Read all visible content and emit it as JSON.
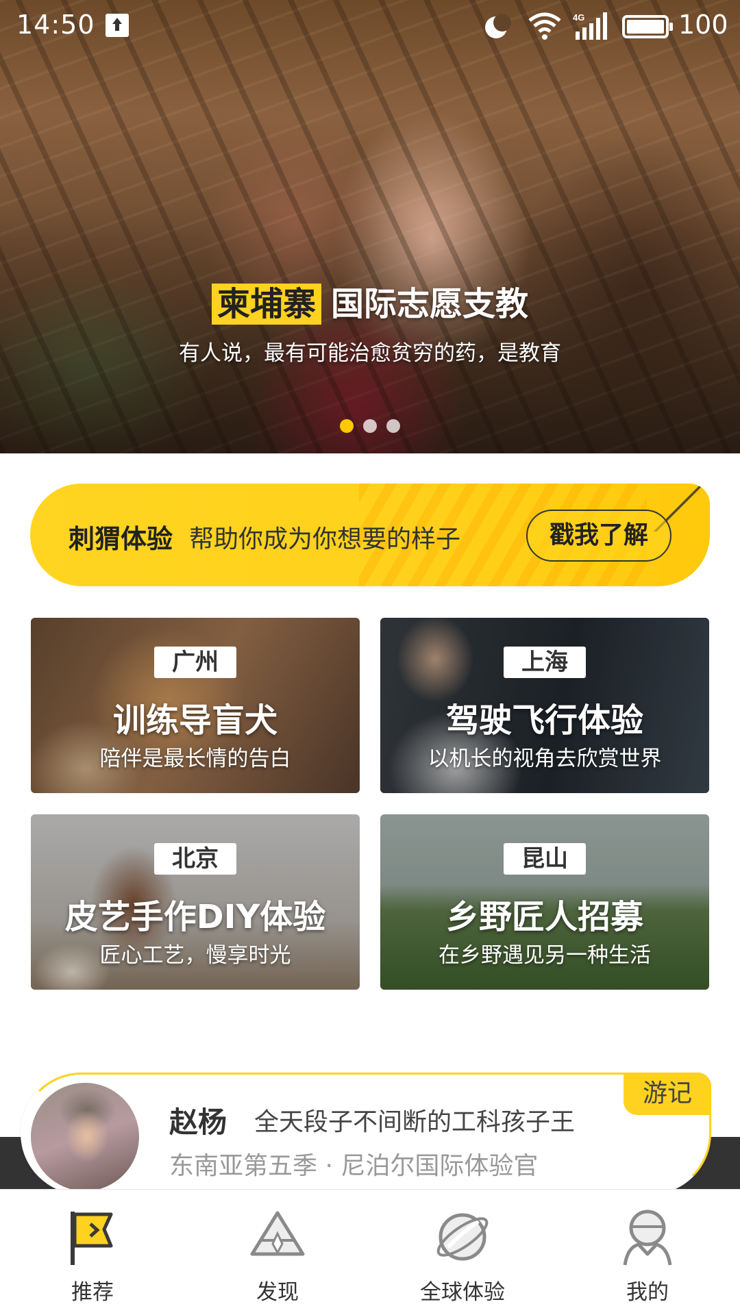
{
  "status_bar": {
    "time": "14:50",
    "battery": "100",
    "icons": [
      "upload-icon",
      "moon-icon",
      "wifi-icon",
      "signal-4g-icon",
      "battery-icon"
    ]
  },
  "hero": {
    "tag": "柬埔寨",
    "title": "国际志愿支教",
    "subtitle": "有人说，最有可能治愈贫穷的药，是教育",
    "slides": 3,
    "active_slide": 1
  },
  "promo": {
    "brand": "刺猬体验",
    "slogan": "帮助你成为你想要的样子",
    "button": "戳我了解"
  },
  "cards": [
    {
      "city": "广州",
      "title": "训练导盲犬",
      "subtitle": "陪伴是最长情的告白"
    },
    {
      "city": "上海",
      "title": "驾驶飞行体验",
      "subtitle": "以机长的视角去欣赏世界"
    },
    {
      "city": "北京",
      "title": "皮艺手作DIY体验",
      "subtitle": "匠心工艺，慢享时光"
    },
    {
      "city": "昆山",
      "title": "乡野匠人招募",
      "subtitle": "在乡野遇见另一种生活"
    }
  ],
  "story": {
    "name": "赵杨",
    "bio": "全天段子不间断的工科孩子王",
    "meta": "东南亚第五季 · 尼泊尔国际体验官",
    "badge": "游记"
  },
  "nav": [
    {
      "label": "推荐",
      "icon": "flag-icon",
      "active": true
    },
    {
      "label": "发现",
      "icon": "discover-icon",
      "active": false
    },
    {
      "label": "全球体验",
      "icon": "planet-icon",
      "active": false
    },
    {
      "label": "我的",
      "icon": "profile-icon",
      "active": false
    }
  ],
  "colors": {
    "accent": "#ffd21f",
    "active_dot": "#ffc800",
    "text": "#333333",
    "muted": "#999999"
  }
}
